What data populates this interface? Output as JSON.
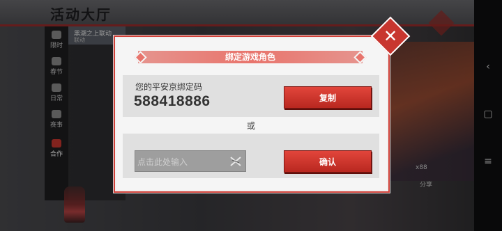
{
  "background": {
    "page_title": "活动大厅",
    "sidebar": [
      {
        "label": "限时"
      },
      {
        "label": "春节"
      },
      {
        "label": "日常"
      },
      {
        "label": "赛事"
      },
      {
        "label": "合作"
      }
    ],
    "first_event": {
      "title": "黑潮之上联动",
      "sub": "联动"
    },
    "right_nav": [
      "‹",
      "▢",
      "≡"
    ],
    "share_label": "分享",
    "coin_text": "x88"
  },
  "dialog": {
    "title": "绑定游戏角色",
    "code_label": "您的平安京绑定码",
    "code_value": "588418886",
    "copy_label": "复制",
    "or_text": "或",
    "input_placeholder": "点击此处输入",
    "input_value": "",
    "confirm_label": "确认",
    "close_symbol": "✕"
  },
  "colors": {
    "accent_red": "#c8362f",
    "header_pink": "#e8746c",
    "panel_gray": "#e0e0e0"
  }
}
